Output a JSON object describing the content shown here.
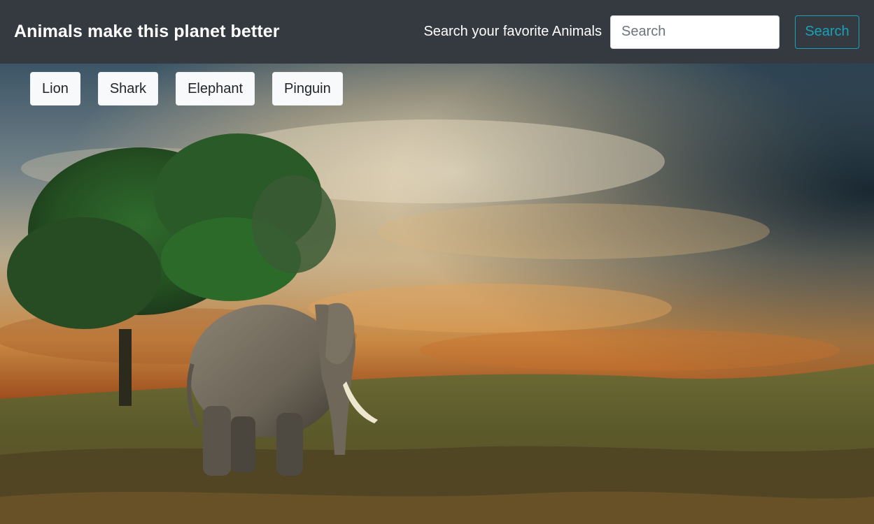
{
  "navbar": {
    "brand": "Animals make this planet better",
    "search_label": "Search your favorite Animals",
    "search_placeholder": "Search",
    "search_value": "",
    "search_button_label": "Search"
  },
  "animal_buttons": [
    {
      "label": "Lion"
    },
    {
      "label": "Shark"
    },
    {
      "label": "Elephant"
    },
    {
      "label": "Pinguin"
    }
  ],
  "hero_image": {
    "description_icon": "elephant-landscape-image"
  },
  "colors": {
    "navbar_bg": "#343a40",
    "accent": "#17a2b8",
    "chip_bg": "#f8f9fa"
  }
}
